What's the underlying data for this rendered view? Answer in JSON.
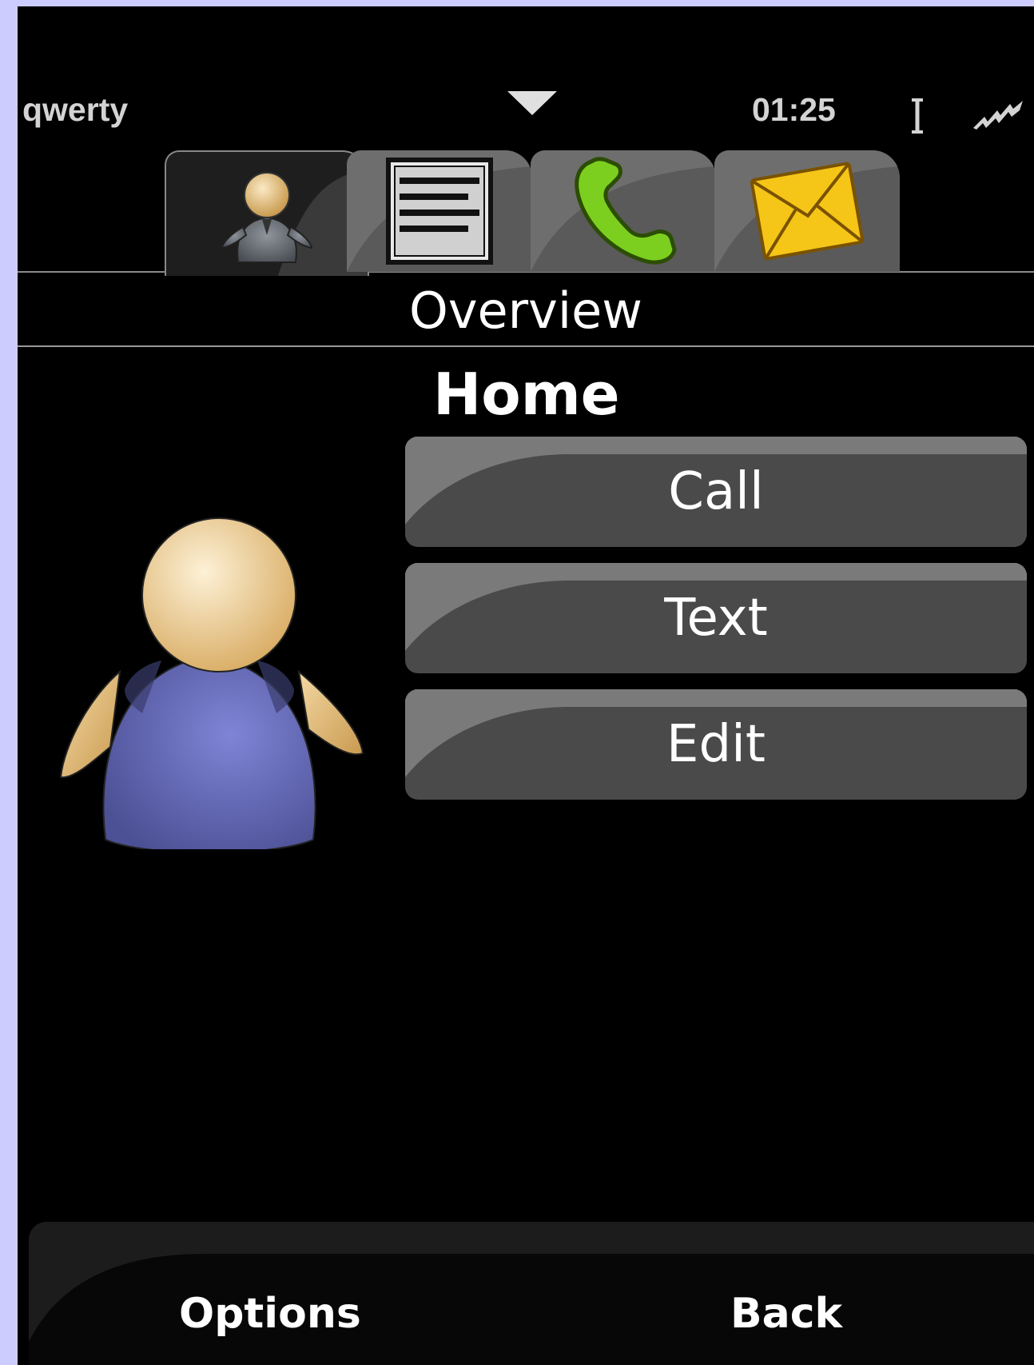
{
  "status_bar": {
    "input_mode": "qwerty",
    "time": "01:25",
    "menu_indicator_icon": "triangle-down-icon",
    "cursor_icon": "text-cursor-icon",
    "signal_icon": "signal-strength-icon"
  },
  "tabs": [
    {
      "icon": "contact-person-icon",
      "active": true
    },
    {
      "icon": "document-lines-icon",
      "active": false
    },
    {
      "icon": "phone-handset-icon",
      "active": false
    },
    {
      "icon": "envelope-icon",
      "active": false
    }
  ],
  "view_title": "Overview",
  "contact": {
    "avatar_icon": "person-avatar-icon",
    "label": "Home"
  },
  "actions": {
    "call": "Call",
    "text": "Text",
    "edit": "Edit"
  },
  "softkeys": {
    "left": "Options",
    "right": "Back"
  },
  "colors": {
    "page_background": "#ccccff",
    "screen_background": "#000000",
    "button_fill": "#4a4a4a",
    "tab_active": "#1e1e1e",
    "tab_inactive": "#5a5a5a",
    "phone_green": "#7ccf1e",
    "envelope_yellow": "#f5c518",
    "avatar_body": "#6a6ab8",
    "avatar_skin": "#e8c98a"
  }
}
